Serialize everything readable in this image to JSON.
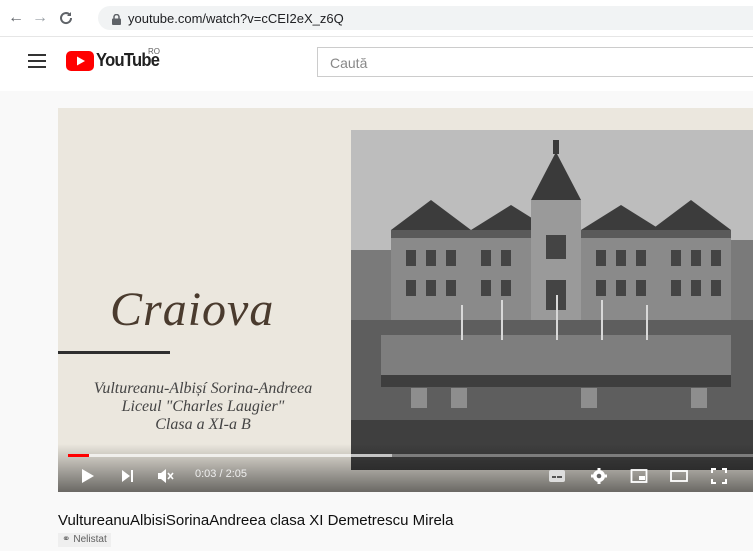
{
  "browser": {
    "url": "youtube.com/watch?v=cCEI2eX_z6Q",
    "back_icon": "arrow-left-icon",
    "forward_icon": "arrow-right-icon",
    "reload_icon": "reload-icon",
    "lock_icon": "lock-icon"
  },
  "header": {
    "menu_icon": "hamburger-menu-icon",
    "logo_text": "YouTube",
    "region": "RO",
    "search_placeholder": "Caută"
  },
  "video": {
    "slide_title": "Craiova",
    "slide_lines": [
      "Vultureanu-Albișí Sorina-Andreea",
      "Liceul \"Charles Laugier\"",
      "Clasa a XI-a B"
    ],
    "time": "0:03 / 2:05",
    "progress_played": 0.03,
    "progress_buffered": 0.47,
    "controls": [
      "play-icon",
      "next-icon",
      "mute-icon",
      "subtitles-icon",
      "settings-icon",
      "miniplayer-icon",
      "theater-icon",
      "fullscreen-icon"
    ]
  },
  "info": {
    "title": "VultureanuAlbisiSorinaAndreea clasa XI Demetrescu Mirela",
    "visibility": "Nelistat"
  },
  "colors": {
    "brand_red": "#ff0000",
    "slide_bg": "#ebe7de"
  }
}
